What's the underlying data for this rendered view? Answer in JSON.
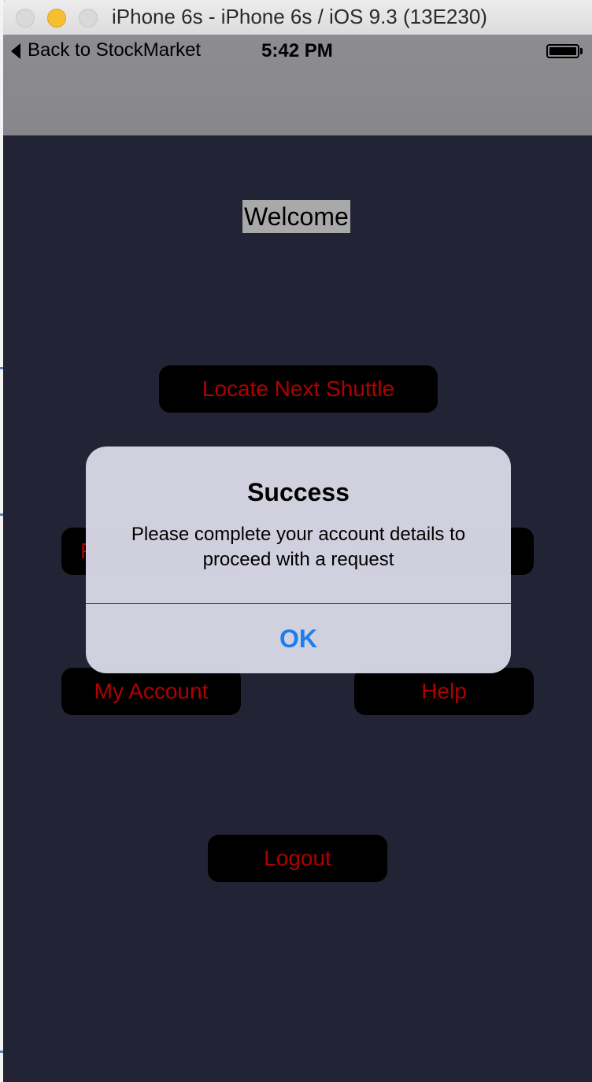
{
  "window": {
    "title": "iPhone 6s - iPhone 6s / iOS 9.3 (13E230)"
  },
  "status_bar": {
    "back_label": "Back to StockMarket",
    "time": "5:42 PM"
  },
  "screen": {
    "welcome": "Welcome",
    "buttons": {
      "locate": "Locate Next Shuttle",
      "left_mid": "R",
      "right_mid": "",
      "my_account": "My Account",
      "help": "Help",
      "logout": "Logout"
    }
  },
  "alert": {
    "title": "Success",
    "message": "Please complete your account details to proceed with a request",
    "ok": "OK"
  },
  "colors": {
    "screen_background": "#222334",
    "button_text": "#b00000",
    "alert_action": "#1a7ff0"
  }
}
